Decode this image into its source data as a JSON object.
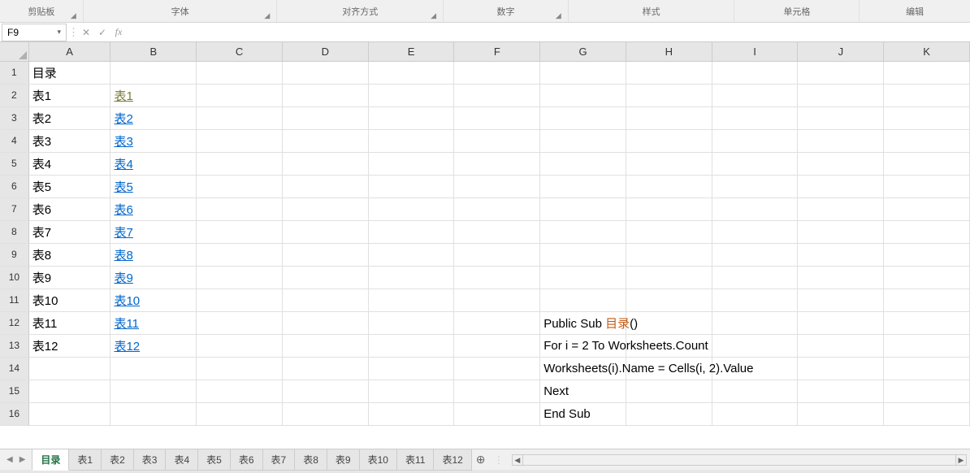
{
  "ribbon": {
    "groups": [
      "剪贴板",
      "字体",
      "对齐方式",
      "数字",
      "样式",
      "单元格",
      "编辑"
    ]
  },
  "formula_bar": {
    "name_box": "F9",
    "cancel": "✕",
    "confirm": "✓",
    "fx": "fx",
    "formula": ""
  },
  "columns": [
    "A",
    "B",
    "C",
    "D",
    "E",
    "F",
    "G",
    "H",
    "I",
    "J",
    "K"
  ],
  "rows": [
    {
      "n": "1",
      "A": "目录",
      "B": "",
      "link": false
    },
    {
      "n": "2",
      "A": "表1",
      "B": "表1",
      "link": true,
      "visited": true
    },
    {
      "n": "3",
      "A": "表2",
      "B": "表2",
      "link": true
    },
    {
      "n": "4",
      "A": "表3",
      "B": "表3",
      "link": true
    },
    {
      "n": "5",
      "A": "表4",
      "B": "表4",
      "link": true
    },
    {
      "n": "6",
      "A": "表5",
      "B": "表5",
      "link": true
    },
    {
      "n": "7",
      "A": "表6",
      "B": "表6",
      "link": true
    },
    {
      "n": "8",
      "A": "表7",
      "B": "表7",
      "link": true
    },
    {
      "n": "9",
      "A": "表8",
      "B": "表8",
      "link": true
    },
    {
      "n": "10",
      "A": "表9",
      "B": "表9",
      "link": true
    },
    {
      "n": "11",
      "A": "表10",
      "B": "表10",
      "link": true
    },
    {
      "n": "12",
      "A": "表11",
      "B": "表11",
      "link": true
    },
    {
      "n": "13",
      "A": "表12",
      "B": "表12",
      "link": true
    },
    {
      "n": "14",
      "A": "",
      "B": ""
    },
    {
      "n": "15",
      "A": "",
      "B": ""
    },
    {
      "n": "16",
      "A": "",
      "B": ""
    }
  ],
  "code": {
    "line1_pre": "Public Sub ",
    "line1_sub": "目录",
    "line1_post": "()",
    "line2_pre": "For i = ",
    "line2_num": "2",
    "line2_post": " To Worksheets.Count",
    "line3_pre": "Worksheets(i).Name = Cells(i, ",
    "line3_num": "2",
    "line3_post": ").Value",
    "line4": "Next",
    "line5": "End Sub"
  },
  "sheets": {
    "tabs": [
      "目录",
      "表1",
      "表2",
      "表3",
      "表4",
      "表5",
      "表6",
      "表7",
      "表8",
      "表9",
      "表10",
      "表11",
      "表12"
    ],
    "active": "目录"
  }
}
